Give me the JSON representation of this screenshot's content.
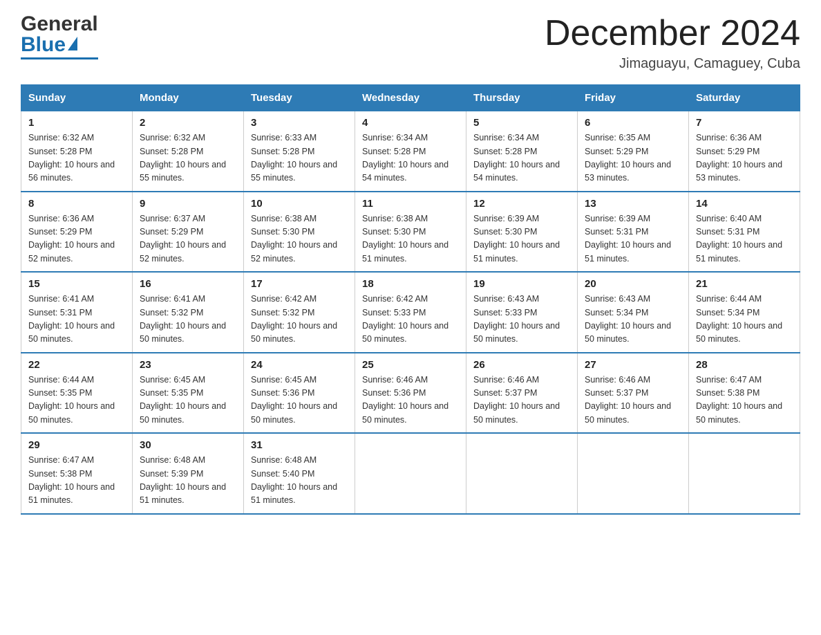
{
  "logo": {
    "line1": "General",
    "line2": "Blue"
  },
  "title": "December 2024",
  "location": "Jimaguayu, Camaguey, Cuba",
  "days_of_week": [
    "Sunday",
    "Monday",
    "Tuesday",
    "Wednesday",
    "Thursday",
    "Friday",
    "Saturday"
  ],
  "weeks": [
    [
      {
        "day": "1",
        "sunrise": "6:32 AM",
        "sunset": "5:28 PM",
        "daylight": "10 hours and 56 minutes."
      },
      {
        "day": "2",
        "sunrise": "6:32 AM",
        "sunset": "5:28 PM",
        "daylight": "10 hours and 55 minutes."
      },
      {
        "day": "3",
        "sunrise": "6:33 AM",
        "sunset": "5:28 PM",
        "daylight": "10 hours and 55 minutes."
      },
      {
        "day": "4",
        "sunrise": "6:34 AM",
        "sunset": "5:28 PM",
        "daylight": "10 hours and 54 minutes."
      },
      {
        "day": "5",
        "sunrise": "6:34 AM",
        "sunset": "5:28 PM",
        "daylight": "10 hours and 54 minutes."
      },
      {
        "day": "6",
        "sunrise": "6:35 AM",
        "sunset": "5:29 PM",
        "daylight": "10 hours and 53 minutes."
      },
      {
        "day": "7",
        "sunrise": "6:36 AM",
        "sunset": "5:29 PM",
        "daylight": "10 hours and 53 minutes."
      }
    ],
    [
      {
        "day": "8",
        "sunrise": "6:36 AM",
        "sunset": "5:29 PM",
        "daylight": "10 hours and 52 minutes."
      },
      {
        "day": "9",
        "sunrise": "6:37 AM",
        "sunset": "5:29 PM",
        "daylight": "10 hours and 52 minutes."
      },
      {
        "day": "10",
        "sunrise": "6:38 AM",
        "sunset": "5:30 PM",
        "daylight": "10 hours and 52 minutes."
      },
      {
        "day": "11",
        "sunrise": "6:38 AM",
        "sunset": "5:30 PM",
        "daylight": "10 hours and 51 minutes."
      },
      {
        "day": "12",
        "sunrise": "6:39 AM",
        "sunset": "5:30 PM",
        "daylight": "10 hours and 51 minutes."
      },
      {
        "day": "13",
        "sunrise": "6:39 AM",
        "sunset": "5:31 PM",
        "daylight": "10 hours and 51 minutes."
      },
      {
        "day": "14",
        "sunrise": "6:40 AM",
        "sunset": "5:31 PM",
        "daylight": "10 hours and 51 minutes."
      }
    ],
    [
      {
        "day": "15",
        "sunrise": "6:41 AM",
        "sunset": "5:31 PM",
        "daylight": "10 hours and 50 minutes."
      },
      {
        "day": "16",
        "sunrise": "6:41 AM",
        "sunset": "5:32 PM",
        "daylight": "10 hours and 50 minutes."
      },
      {
        "day": "17",
        "sunrise": "6:42 AM",
        "sunset": "5:32 PM",
        "daylight": "10 hours and 50 minutes."
      },
      {
        "day": "18",
        "sunrise": "6:42 AM",
        "sunset": "5:33 PM",
        "daylight": "10 hours and 50 minutes."
      },
      {
        "day": "19",
        "sunrise": "6:43 AM",
        "sunset": "5:33 PM",
        "daylight": "10 hours and 50 minutes."
      },
      {
        "day": "20",
        "sunrise": "6:43 AM",
        "sunset": "5:34 PM",
        "daylight": "10 hours and 50 minutes."
      },
      {
        "day": "21",
        "sunrise": "6:44 AM",
        "sunset": "5:34 PM",
        "daylight": "10 hours and 50 minutes."
      }
    ],
    [
      {
        "day": "22",
        "sunrise": "6:44 AM",
        "sunset": "5:35 PM",
        "daylight": "10 hours and 50 minutes."
      },
      {
        "day": "23",
        "sunrise": "6:45 AM",
        "sunset": "5:35 PM",
        "daylight": "10 hours and 50 minutes."
      },
      {
        "day": "24",
        "sunrise": "6:45 AM",
        "sunset": "5:36 PM",
        "daylight": "10 hours and 50 minutes."
      },
      {
        "day": "25",
        "sunrise": "6:46 AM",
        "sunset": "5:36 PM",
        "daylight": "10 hours and 50 minutes."
      },
      {
        "day": "26",
        "sunrise": "6:46 AM",
        "sunset": "5:37 PM",
        "daylight": "10 hours and 50 minutes."
      },
      {
        "day": "27",
        "sunrise": "6:46 AM",
        "sunset": "5:37 PM",
        "daylight": "10 hours and 50 minutes."
      },
      {
        "day": "28",
        "sunrise": "6:47 AM",
        "sunset": "5:38 PM",
        "daylight": "10 hours and 50 minutes."
      }
    ],
    [
      {
        "day": "29",
        "sunrise": "6:47 AM",
        "sunset": "5:38 PM",
        "daylight": "10 hours and 51 minutes."
      },
      {
        "day": "30",
        "sunrise": "6:48 AM",
        "sunset": "5:39 PM",
        "daylight": "10 hours and 51 minutes."
      },
      {
        "day": "31",
        "sunrise": "6:48 AM",
        "sunset": "5:40 PM",
        "daylight": "10 hours and 51 minutes."
      },
      null,
      null,
      null,
      null
    ]
  ]
}
